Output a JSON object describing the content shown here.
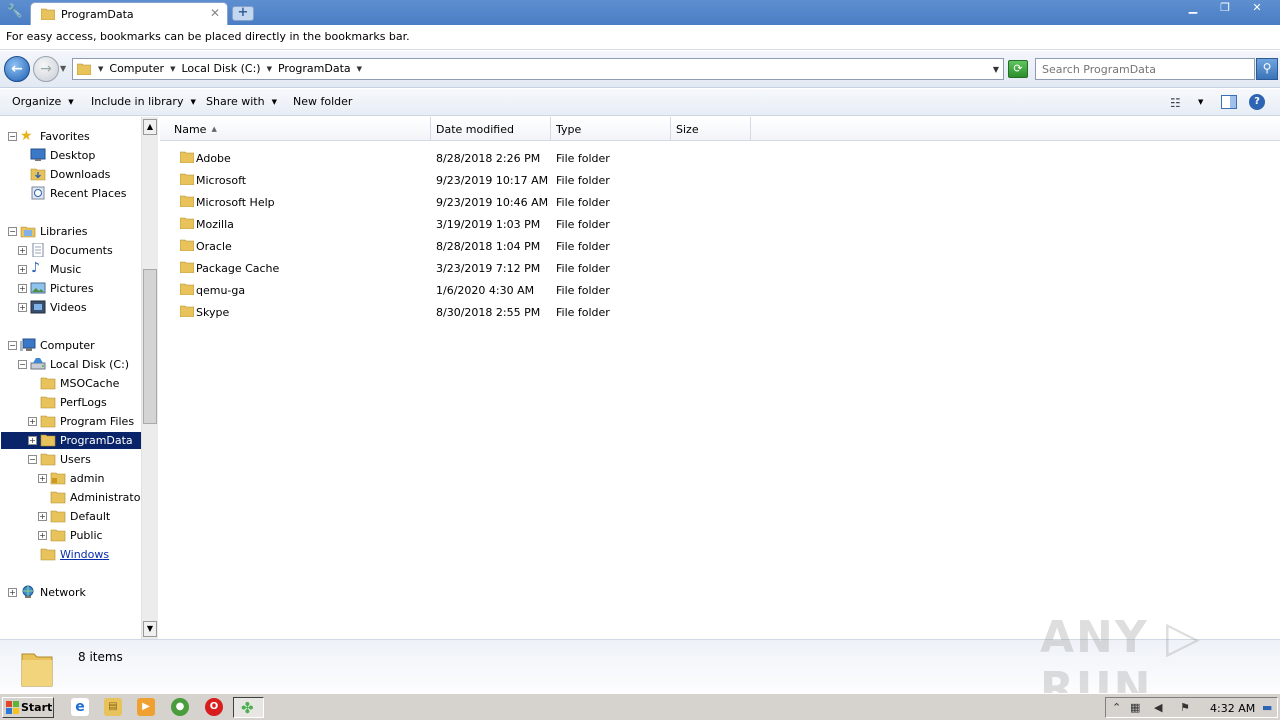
{
  "browser": {
    "tab_title": "ProgramData",
    "tab_close": "✕",
    "new_tab": "+",
    "bookmarks_hint": "For easy access, bookmarks can be placed directly in the bookmarks bar.",
    "window_controls": {
      "minimize": "▁",
      "maximize": "❐",
      "close": "✕"
    }
  },
  "address": {
    "breadcrumbs": [
      "Computer",
      "Local Disk (C:)",
      "ProgramData"
    ],
    "search_placeholder": "Search ProgramData"
  },
  "commands": {
    "organize": "Organize",
    "include_in_library": "Include in library",
    "share_with": "Share with",
    "new_folder": "New folder"
  },
  "nav": {
    "favorites": "Favorites",
    "desktop": "Desktop",
    "downloads": "Downloads",
    "recent_places": "Recent Places",
    "libraries": "Libraries",
    "documents": "Documents",
    "music": "Music",
    "pictures": "Pictures",
    "videos": "Videos",
    "computer": "Computer",
    "local_disk": "Local Disk (C:)",
    "msocache": "MSOCache",
    "perflogs": "PerfLogs",
    "program_files": "Program Files",
    "programdata": "ProgramData",
    "users": "Users",
    "admin": "admin",
    "administrator": "Administrator",
    "default": "Default",
    "public": "Public",
    "windows": "Windows",
    "network": "Network"
  },
  "columns": {
    "name": "Name",
    "date_modified": "Date modified",
    "type": "Type",
    "size": "Size"
  },
  "files": [
    {
      "name": "Adobe",
      "date": "8/28/2018 2:26 PM",
      "type": "File folder"
    },
    {
      "name": "Microsoft",
      "date": "9/23/2019 10:17 AM",
      "type": "File folder"
    },
    {
      "name": "Microsoft Help",
      "date": "9/23/2019 10:46 AM",
      "type": "File folder"
    },
    {
      "name": "Mozilla",
      "date": "3/19/2019 1:03 PM",
      "type": "File folder"
    },
    {
      "name": "Oracle",
      "date": "8/28/2018 1:04 PM",
      "type": "File folder"
    },
    {
      "name": "Package Cache",
      "date": "3/23/2019 7:12 PM",
      "type": "File folder"
    },
    {
      "name": "qemu-ga",
      "date": "1/6/2020 4:30 AM",
      "type": "File folder"
    },
    {
      "name": "Skype",
      "date": "8/30/2018 2:55 PM",
      "type": "File folder"
    }
  ],
  "status": {
    "item_count": "8 items"
  },
  "watermark": "ANY ▷ RUN",
  "taskbar": {
    "start": "Start",
    "clock": "4:32 AM"
  },
  "colors": {
    "folder": "#e8c25a",
    "selection": "#0a246a",
    "titlebar": "#5d8fd0"
  }
}
